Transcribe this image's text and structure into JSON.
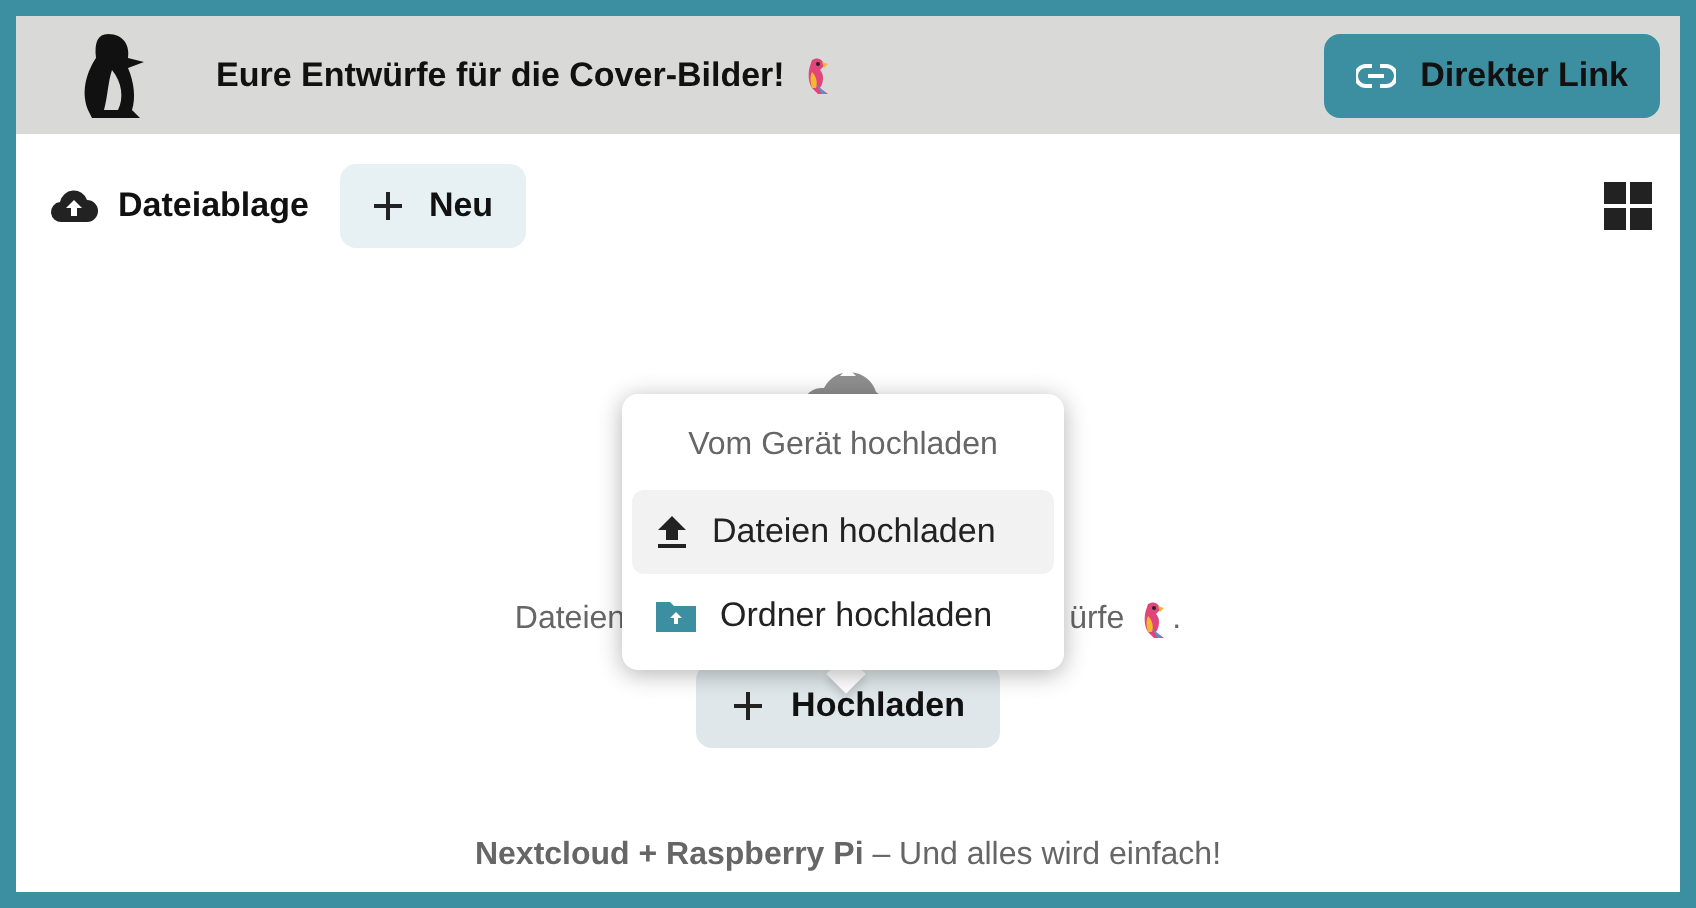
{
  "header": {
    "title": "Eure Entwürfe für die Cover-Bilder!",
    "link_button": "Direkter Link"
  },
  "toolbar": {
    "title": "Dateiablage",
    "new_button": "Neu"
  },
  "empty_state": {
    "text_left": "Dateien",
    "text_right": "ürfe",
    "text_end": ".",
    "upload_button": "Hochladen"
  },
  "upload_menu": {
    "heading": "Vom Gerät hochladen",
    "items": [
      {
        "kind": "file",
        "label": "Dateien hochladen",
        "selected": true
      },
      {
        "kind": "folder",
        "label": "Ordner hochladen",
        "selected": false
      }
    ]
  },
  "footer": "**Nextcloud + Raspberry Pi** – Und alles wird einfach!"
}
